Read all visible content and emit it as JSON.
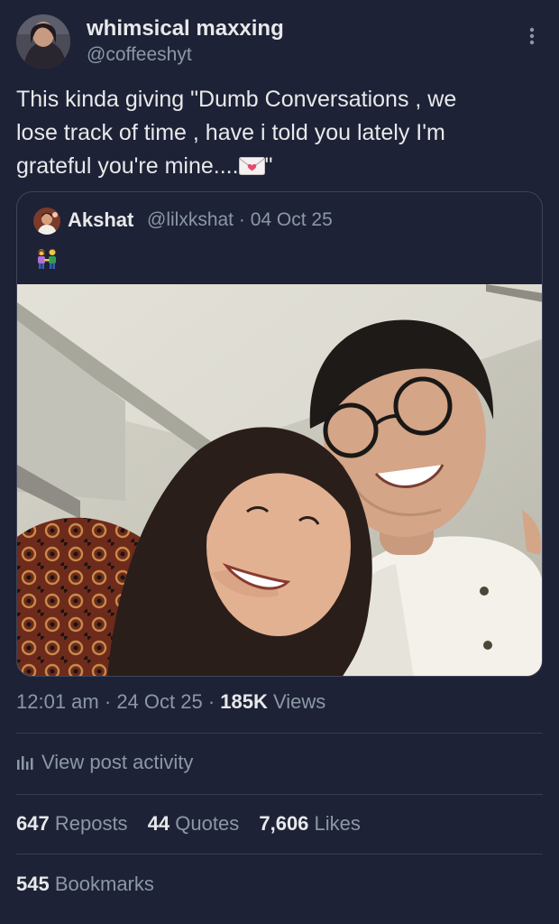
{
  "author": {
    "display_name": "whimsical maxxing",
    "handle": "@coffeeshyt"
  },
  "tweet": {
    "text_lines": [
      "This kinda giving \"Dumb Conversations , we",
      "lose track of time , have i told you lately I'm",
      "grateful you're mine...."
    ],
    "text_end": "\"",
    "emoji": "love-letter-envelope"
  },
  "quote": {
    "display_name": "Akshat",
    "handle": "@lilxkshat",
    "separator": "·",
    "date": "04 Oct 25",
    "emoji": "people-holding-hands",
    "photo": "selfie-of-smiling-couple"
  },
  "meta": {
    "time": "12:01 am",
    "separator": "·",
    "date": "24 Oct 25",
    "views_count": "185K",
    "views_label": "Views"
  },
  "activity": {
    "label": "View post activity"
  },
  "stats": {
    "reposts": {
      "count": "647",
      "label": "Reposts"
    },
    "quotes": {
      "count": "44",
      "label": "Quotes"
    },
    "likes": {
      "count": "7,606",
      "label": "Likes"
    },
    "bookmarks": {
      "count": "545",
      "label": "Bookmarks"
    }
  },
  "colors": {
    "background": "#1e2236",
    "primary_text": "#e7e9ea",
    "secondary_text": "#8b98a5",
    "border": "#3e4459",
    "divider": "#363b4f"
  }
}
